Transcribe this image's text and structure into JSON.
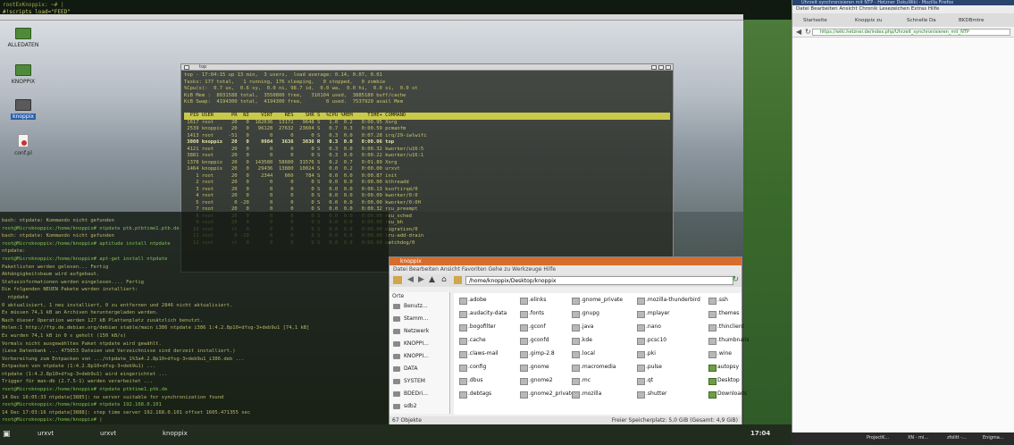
{
  "top_terminal": {
    "line1": "rootExKnoppix: ~# |",
    "line2": "#!scripts_load=\"FEED\""
  },
  "desktop": {
    "icons": [
      {
        "label": "ALLEDATEN",
        "icon": "folder-icon"
      },
      {
        "label": "KNOPPIX",
        "icon": "folder-icon"
      },
      {
        "label": "knoppix",
        "icon": "folder-icon"
      },
      {
        "label": "conf.pl",
        "icon": "script-file-icon"
      }
    ]
  },
  "top_window": {
    "title": "top",
    "lines": [
      "top - 17:04:15 up 13 min,  3 users,  load average: 0.14, 0.07, 0.01",
      "Tasks: 177 total,   1 running, 176 sleeping,   0 stopped,   0 zombie",
      "%Cpu(s):  0.7 us,  0.6 sy,  0.0 ni, 98.7 id,  0.0 wa,  0.0 hi,  0.0 si,  0.0 st",
      "KiB Mem :  8031588 total,  3550800 free,   310104 used,  3885180 buff/cache",
      "KiB Swap:  4194300 total,  4194300 free,        0 used.  7537920 avail Mem",
      "",
      "  PID USER      PR  NI    VIRT    RES    SHR S  %CPU %MEM     TIME+ COMMAND",
      " 1617 root      20   0  182636  13172   9648 S   1.0  0.2   0:00.95 Xorg",
      " 2539 knoppix   20   0   96128  27632  23604 S   0.7  0.3   0:00.59 pcmanfm",
      " 1413 root     -51   0       0      0      0 S   0.3  0.0   0:07.28 irq/29-iwlwifi",
      " 3080 knoppix   20   0    9984   3636   3036 R   0.3  0.0   0:00.06 top",
      " 4121 root      20   0       0      0      0 S   0.3  0.0   0:00.32 kworker/u16:5",
      " 3881 root      20   0       0      0      0 S   0.3  0.0   0:00.22 kworker/u16:1",
      " 1378 knoppix   20   0  143580  58680  31576 S   0.2  0.7   0:01.89 Xorg",
      " 1464 knoppix   20   0   29436  13880  10024 S   0.0  0.2   0:00.00 urxvt",
      "    1 root      20   0    2344    660    784 S   0.0  0.0   0:00.87 init",
      "    2 root      20   0       0      0      0 S   0.0  0.0   0:00.00 kthreadd",
      "    3 root      20   0       0      0      0 S   0.0  0.0   0:00.13 ksoftirqd/0",
      "    4 root      20   0       0      0      0 S   0.0  0.0   0:00.09 kworker/0:0",
      "    5 root       0 -20       0      0      0 S   0.0  0.0   0:00.00 kworker/0:0H",
      "    7 root      20   0       0      0      0 S   0.0  0.0   0:00.32 rcu_preempt",
      "    8 root      20   0       0      0      0 S   0.0  0.0   0:00.00 rcu_sched",
      "    9 root      20   0       0      0      0 S   0.0  0.0   0:00.00 rcu_bh",
      "   10 root      rt   0       0      0      0 S   0.0  0.0   0:00.00 migration/0",
      "   11 root       0 -20       0      0      0 S   0.0  0.0   0:00.00 lru-add-drain",
      "   12 root      rt   0       0      0      0 S   0.0  0.0   0:00.00 watchdog/0"
    ]
  },
  "terminal": {
    "lines": [
      "bash: ntpdate: Kommando nicht gefunden",
      "root@Microknoppix:/home/knoppix# ntpdate ptb.ptbtime1.ptb.de",
      "bash: ntpdate: Kommando nicht gefunden",
      "root@Microknoppix:/home/knoppix# aptitude install ntpdate",
      "ntpdate:",
      "root@Microknoppix:/home/knoppix# apt-get install ntpdate",
      "Paketlisten werden gelesen... Fertig",
      "Abhängigkeitsbaum wird aufgebaut.",
      "Statusinformationen werden eingelesen.... Fertig",
      "Die folgenden NEUEN Pakete werden installiert:",
      "  ntpdate",
      "0 aktualisiert, 1 neu installiert, 0 zu entfernen und 2846 nicht aktualisiert.",
      "Es müssen 74,1 kB an Archiven heruntergeladen werden.",
      "Nach dieser Operation werden 127 kB Plattenplatz zusätzlich benutzt.",
      "Holen:1 http://ftp.de.debian.org/debian stable/main i386 ntpdate i386 1:4.2.8p10+dfsg-3+deb9u1 [74,1 kB]",
      "Es wurden 74,1 kB in 0 s geholt (150 kB/s)",
      "Vormals nicht ausgewähltes Paket ntpdate wird gewählt.",
      "(Lese Datenbank ... 475053 Dateien und Verzeichnisse sind derzeit installiert.)",
      "Vorbereitung zum Entpacken von .../ntpdate_1%3a4.2.8p10+dfsg-3+deb9u1_i386.deb ...",
      "Entpacken von ntpdate (1:4.2.8p10+dfsg-3+deb9u1) ...",
      "ntpdate (1:4.2.8p10+dfsg-3+deb9u1) wird eingerichtet ...",
      "Trigger für man-db (2.7.5-1) werden verarbeitet ...",
      "root@Microknoppix:/home/knoppix# ntpdate ptbtime1.ptb.de",
      "14 Dec 16:05:33 ntpdate[3885]: no server suitable for synchronization found",
      "root@Microknoppix:/home/knoppix# ntpdate 192.168.0.101",
      "14 Dec 17:03:16 ntpdate[3888]: step time server 192.168.0.101 offset 1605.471355 sec",
      "root@Microknoppix:/home/knoppix# |"
    ]
  },
  "file_manager": {
    "title": "knoppix",
    "menu": "Datei  Bearbeiten  Ansicht  Favoriten  Gehe zu  Werkzeuge  Hilfe",
    "path": "/home/knoppix/Desktop/knoppix",
    "sidebar_header": "Orte",
    "sidebar": [
      "Benutz...",
      "Stamm...",
      "Netzwerk",
      "KNOPPI...",
      "KNOPPI...",
      "DATA",
      "SYSTEM",
      "BDEDri...",
      "sdb2"
    ],
    "items": [
      [
        ".adobe",
        ".elinks",
        ".gnome_private",
        ".mozilla-thunderbird",
        ".ssh"
      ],
      [
        ".audacity-data",
        ".fonts",
        ".gnupg",
        ".mplayer",
        ".themes"
      ],
      [
        ".bogofilter",
        ".gconf",
        ".java",
        ".nano",
        ".thinclient"
      ],
      [
        ".cache",
        ".gconfd",
        ".kde",
        ".pcsc10",
        ".thumbnails"
      ],
      [
        ".claws-mail",
        ".gimp-2.8",
        ".local",
        ".pki",
        ".wine"
      ],
      [
        ".config",
        ".gnome",
        ".macromedia",
        ".pulse",
        "autopsy"
      ],
      [
        ".dbus",
        ".gnome2",
        ".mc",
        ".qt",
        "Desktop"
      ],
      [
        ".debtags",
        ".gnome2_private",
        ".mozilla",
        ".shutter",
        "Downloads"
      ]
    ],
    "status_left": "67 Objekte",
    "status_right": "Freier Speicherplatz: 5,0 GiB (Gesamt: 4,9 GiB)"
  },
  "browser": {
    "title": "Uhrzeit synchronisieren mit NTP - Hetzner DokuWiki - Mozilla Firefox",
    "menu": "Datei  Bearbeiten  Ansicht  Chronik  Lesezeichen  Extras  Hilfe",
    "tabs": [
      "Startseite",
      "Knoppix zu",
      "Schnelle Da",
      "BKDBmtre"
    ],
    "url": "https://wiki.hetzner.de/index.php/Uhrzeit_synchronisieren_mit_NTP"
  },
  "taskbar": {
    "tasks": [
      "urxvt",
      "urxvt",
      "knoppix"
    ],
    "clock": "17:04"
  },
  "taskbar2": {
    "tasks": [
      "ProjectK...",
      "XN - mi...",
      "zfslitt -...",
      "Enigma..."
    ]
  }
}
